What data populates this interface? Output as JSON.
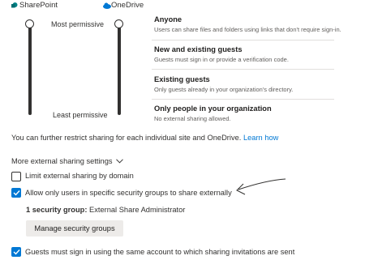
{
  "header": {
    "sharepoint_label": "SharePoint",
    "onedrive_label": "OneDrive",
    "sharepoint_icon": "sharepoint-icon",
    "onedrive_icon": "onedrive-icon"
  },
  "sliders": {
    "top_label": "Most permissive",
    "bottom_label": "Least permissive"
  },
  "levels": [
    {
      "title": "Anyone",
      "desc": "Users can share files and folders using links that don't require sign-in."
    },
    {
      "title": "New and existing guests",
      "desc": "Guests must sign in or provide a verification code."
    },
    {
      "title": "Existing guests",
      "desc": "Only guests already in your organization's directory."
    },
    {
      "title": "Only people in your organization",
      "desc": "No external sharing allowed."
    }
  ],
  "note": {
    "text": "You can further restrict sharing for each individual site and OneDrive. ",
    "link": "Learn how"
  },
  "more_settings": {
    "title": "More external sharing settings",
    "limit_domain_label": "Limit external sharing by domain",
    "limit_domain_checked": false,
    "allow_groups_label": "Allow only users in specific security groups to share externally",
    "allow_groups_checked": true,
    "security_group_count": "1 security group:",
    "security_group_name": " External Share Administrator",
    "manage_button": "Manage security groups",
    "same_account_label": "Guests must sign in using the same account to which sharing invitations are sent",
    "same_account_checked": true
  },
  "colors": {
    "accent": "#0078d4",
    "sharepoint": "#038387",
    "onedrive": "#0078d4"
  }
}
